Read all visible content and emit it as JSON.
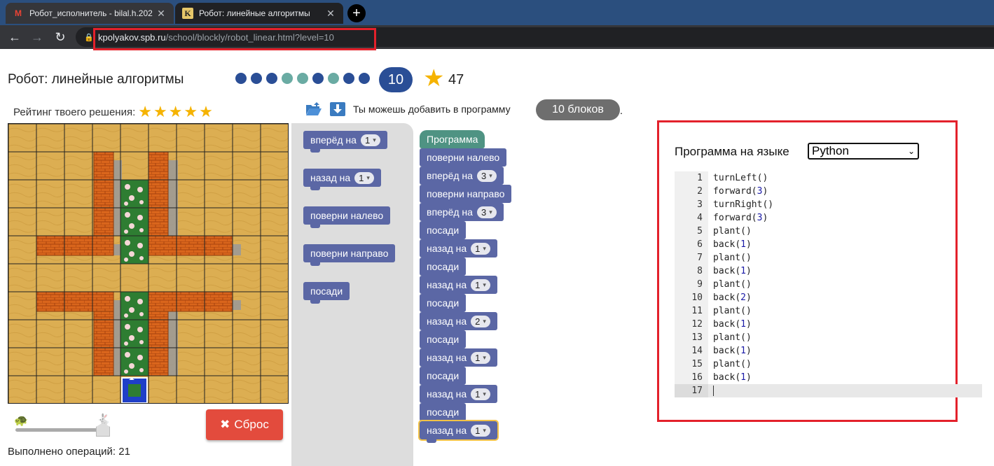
{
  "browser": {
    "tabs": [
      {
        "title": "Робот_исполнитель - bilal.h.202",
        "icon": "gmail-icon"
      },
      {
        "title": "Робот: линейные алгоритмы",
        "icon": "kpolyakov-icon"
      }
    ],
    "url_host": "kpolyakov.spb.ru",
    "url_path": "/school/blockly/robot_linear.html?level=10"
  },
  "header": {
    "title": "Робот: линейные алгоритмы",
    "level_dots": [
      "#2a4e96",
      "#2a4e96",
      "#2a4e96",
      "#6aaba3",
      "#6aaba3",
      "#2a4e96",
      "#6aaba3",
      "#2a4e96",
      "#2a4e96"
    ],
    "current_level": "10",
    "score": "47"
  },
  "rating": {
    "label": "Рейтинг твоего решения:",
    "stars": "★★★★★"
  },
  "hint": {
    "text": "Ты можешь добавить в программу",
    "badge": "10 блоков",
    "suffix": "."
  },
  "toolbox": {
    "blocks": [
      {
        "label": "вперёд на",
        "value": "1"
      },
      {
        "label": "назад на",
        "value": "1"
      },
      {
        "label": "поверни налево",
        "value": null
      },
      {
        "label": "поверни направо",
        "value": null
      },
      {
        "label": "посади",
        "value": null
      }
    ]
  },
  "program": {
    "start_label": "Программа",
    "blocks": [
      {
        "label": "поверни налево",
        "value": null
      },
      {
        "label": "вперёд на",
        "value": "3"
      },
      {
        "label": "поверни направо",
        "value": null
      },
      {
        "label": "вперёд на",
        "value": "3"
      },
      {
        "label": "посади",
        "value": null
      },
      {
        "label": "назад на",
        "value": "1"
      },
      {
        "label": "посади",
        "value": null
      },
      {
        "label": "назад на",
        "value": "1"
      },
      {
        "label": "посади",
        "value": null
      },
      {
        "label": "назад на",
        "value": "2"
      },
      {
        "label": "посади",
        "value": null
      },
      {
        "label": "назад на",
        "value": "1"
      },
      {
        "label": "посади",
        "value": null
      },
      {
        "label": "назад на",
        "value": "1"
      },
      {
        "label": "посади",
        "value": null
      },
      {
        "label": "назад на",
        "value": "1"
      }
    ]
  },
  "controls": {
    "reset_label": "Сброс",
    "ops_label": "Выполнено операций: 21"
  },
  "code_panel": {
    "lang_label": "Программа на языке",
    "lang_selected": "Python",
    "lines": [
      {
        "n": "1",
        "fn": "turnLeft",
        "arg": ""
      },
      {
        "n": "2",
        "fn": "forward",
        "arg": "3"
      },
      {
        "n": "3",
        "fn": "turnRight",
        "arg": ""
      },
      {
        "n": "4",
        "fn": "forward",
        "arg": "3"
      },
      {
        "n": "5",
        "fn": "plant",
        "arg": ""
      },
      {
        "n": "6",
        "fn": "back",
        "arg": "1"
      },
      {
        "n": "7",
        "fn": "plant",
        "arg": ""
      },
      {
        "n": "8",
        "fn": "back",
        "arg": "1"
      },
      {
        "n": "9",
        "fn": "plant",
        "arg": ""
      },
      {
        "n": "10",
        "fn": "back",
        "arg": "2"
      },
      {
        "n": "11",
        "fn": "plant",
        "arg": ""
      },
      {
        "n": "12",
        "fn": "back",
        "arg": "1"
      },
      {
        "n": "13",
        "fn": "plant",
        "arg": ""
      },
      {
        "n": "14",
        "fn": "back",
        "arg": "1"
      },
      {
        "n": "15",
        "fn": "plant",
        "arg": ""
      },
      {
        "n": "16",
        "fn": "back",
        "arg": "1"
      },
      {
        "n": "17",
        "fn": "",
        "arg": ""
      }
    ]
  }
}
